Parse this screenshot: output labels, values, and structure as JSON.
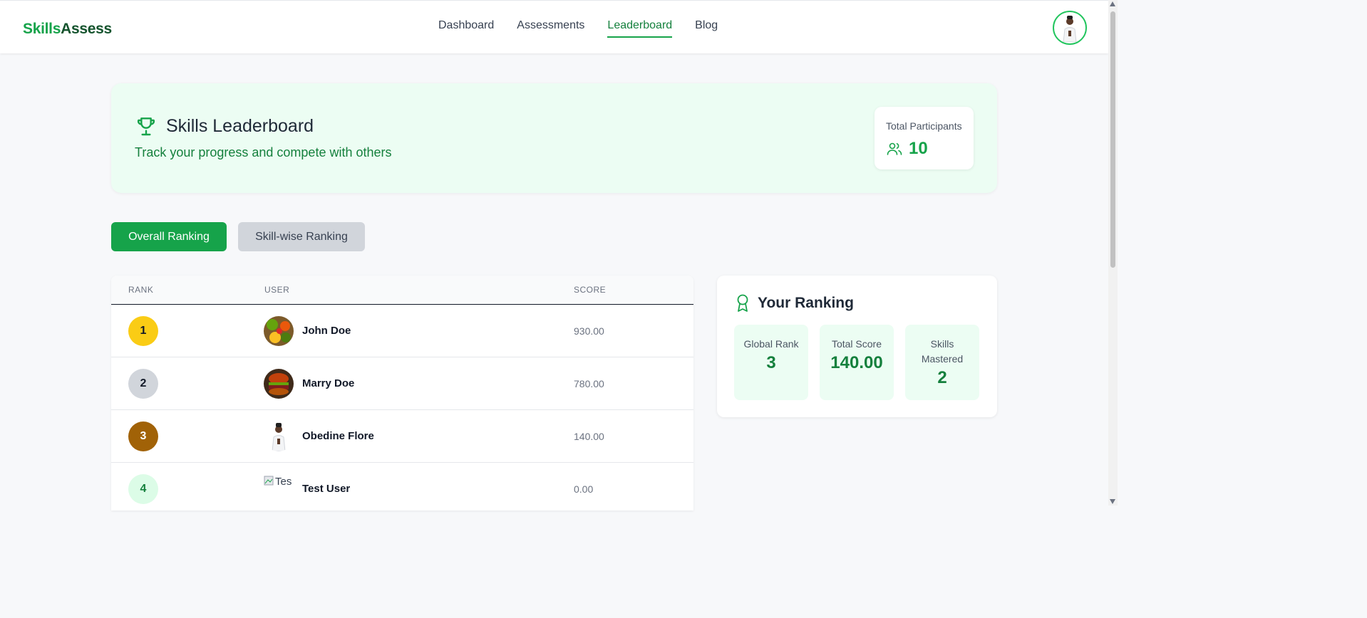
{
  "brand": {
    "part1": "Skills",
    "part2": "Assess"
  },
  "nav": [
    {
      "label": "Dashboard",
      "active": false
    },
    {
      "label": "Assessments",
      "active": false
    },
    {
      "label": "Leaderboard",
      "active": true
    },
    {
      "label": "Blog",
      "active": false
    }
  ],
  "hero": {
    "title": "Skills Leaderboard",
    "subtitle": "Track your progress and compete with others",
    "participants_label": "Total Participants",
    "participants_value": "10"
  },
  "tabs": {
    "overall": "Overall Ranking",
    "skill": "Skill-wise Ranking"
  },
  "table": {
    "headers": {
      "rank": "RANK",
      "user": "USER",
      "score": "SCORE"
    },
    "rows": [
      {
        "rank": "1",
        "name": "John Doe",
        "score": "930.00",
        "badge_color": "#facc15",
        "badge_text": "#111827"
      },
      {
        "rank": "2",
        "name": "Marry Doe",
        "score": "780.00",
        "badge_color": "#d1d5db",
        "badge_text": "#111827"
      },
      {
        "rank": "3",
        "name": "Obedine Flore",
        "score": "140.00",
        "badge_color": "#a16207",
        "badge_text": "#ffffff"
      },
      {
        "rank": "4",
        "name": "Test User",
        "score": "0.00",
        "badge_color": "#dcfce7",
        "badge_text": "#15803d",
        "avatar_alt": "Tes"
      }
    ]
  },
  "your_ranking": {
    "title": "Your Ranking",
    "global_rank_label": "Global Rank",
    "global_rank_value": "3",
    "total_score_label": "Total Score",
    "total_score_value": "140.00",
    "skills_label": "Skills Mastered",
    "skills_value": "2"
  },
  "colors": {
    "accent": "#16a34a",
    "accent_dark": "#15803d",
    "hero_bg": "#ecfdf3"
  }
}
